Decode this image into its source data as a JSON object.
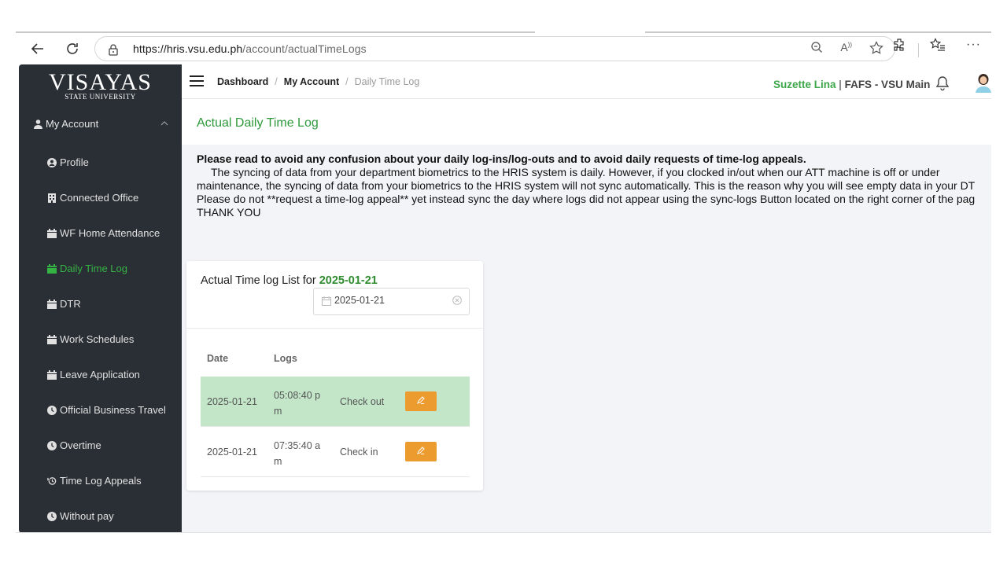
{
  "browser": {
    "url_host": "https://hris.vsu.edu.ph",
    "url_path": "/account/actualTimeLogs"
  },
  "sidebar": {
    "logo_main": "VISAYAS",
    "logo_sub": "STATE UNIVERSITY",
    "section_label": "My Account",
    "items": [
      {
        "label": "Profile",
        "icon": "user-circle-icon"
      },
      {
        "label": "Connected Office",
        "icon": "building-icon"
      },
      {
        "label": "WF Home Attendance",
        "icon": "calendar-icon"
      },
      {
        "label": "Daily Time Log",
        "icon": "calendar-icon",
        "active": true
      },
      {
        "label": "DTR",
        "icon": "calendar-icon"
      },
      {
        "label": "Work Schedules",
        "icon": "calendar-icon"
      },
      {
        "label": "Leave Application",
        "icon": "calendar-icon"
      },
      {
        "label": "Official Business Travel",
        "icon": "clock-icon"
      },
      {
        "label": "Overtime",
        "icon": "clock-icon"
      },
      {
        "label": "Time Log Appeals",
        "icon": "history-icon"
      },
      {
        "label": "Without pay",
        "icon": "clock-icon"
      }
    ],
    "active_color": "#35b244"
  },
  "header": {
    "breadcrumb": [
      "Dashboard",
      "My Account",
      "Daily Time Log"
    ],
    "user_name": "Suzette Lina",
    "separator": "|",
    "org": "FAFS - VSU Main"
  },
  "page": {
    "title": "Actual Daily Time Log",
    "notice_heading": "Please read to avoid any confusion about your daily log-ins/log-outs and to avoid daily requests of time-log appeals.",
    "notice_line1": "The syncing of data from your department biometrics to the HRIS system is daily. However, if you clocked in/out when our ATT machine is off or under",
    "notice_line2": "maintenance, the syncing of data from your biometrics to the HRIS system will not sync automatically. This is the reason why you will see empty data in your DT",
    "notice_line3": "Please do not **request a time-log appeal** yet instead sync the day where logs did not appear using the sync-logs Button located on the right corner of the pag",
    "notice_line4": "THANK YOU"
  },
  "card": {
    "title_prefix": "Actual Time log List for",
    "title_date": "2025-01-21",
    "date_value": "2025-01-21",
    "columns": [
      "Date",
      "Logs"
    ],
    "rows": [
      {
        "date": "2025-01-21",
        "time_line1": "05:08:40 p",
        "time_line2": "m",
        "type": "Check out",
        "highlight": true
      },
      {
        "date": "2025-01-21",
        "time_line1": "07:35:40 a",
        "time_line2": "m",
        "type": "Check in",
        "highlight": false
      }
    ],
    "highlight_color": "#c3e6c9",
    "edit_color": "#ec9b2f"
  }
}
